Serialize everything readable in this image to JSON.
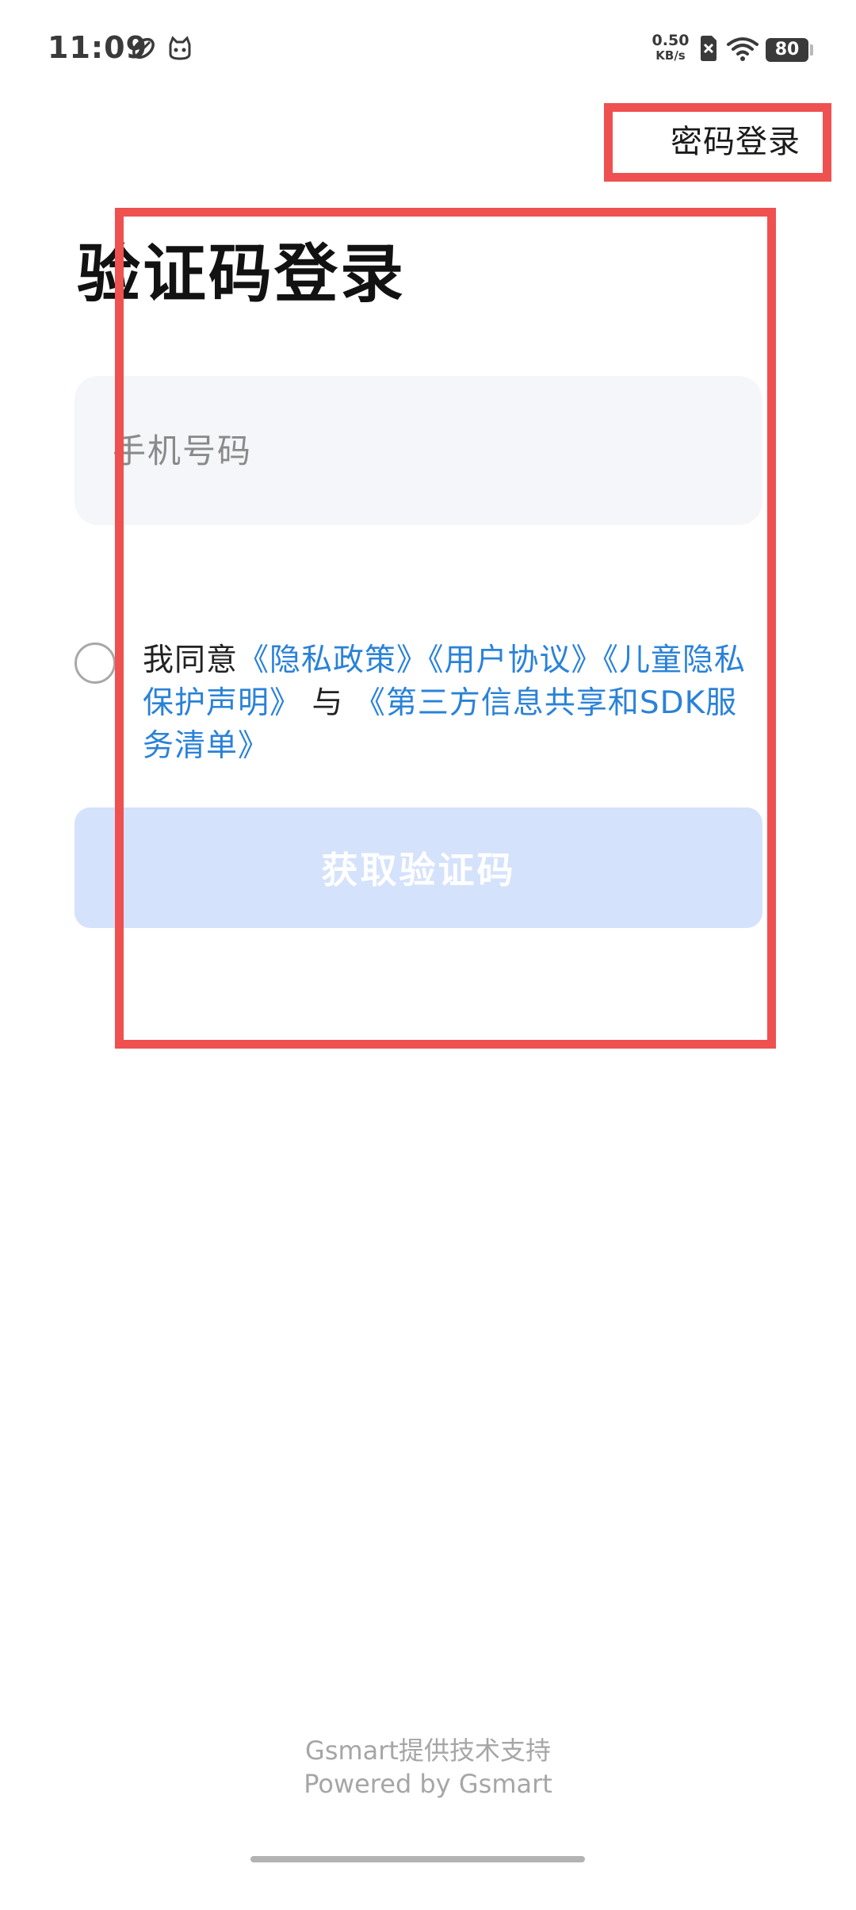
{
  "status_bar": {
    "time": "11:09",
    "net_speed_value": "0.50",
    "net_speed_unit": "KB/s",
    "battery_level": "80",
    "icons": [
      "rugby-ball-icon",
      "cat-face-icon",
      "sim-disabled-icon",
      "wifi-icon",
      "battery-icon"
    ]
  },
  "header": {
    "password_login": "密码登录"
  },
  "title": "验证码登录",
  "phone": {
    "placeholder": "手机号码",
    "value": ""
  },
  "agreement": {
    "prefix": "我同意",
    "privacy_policy": "《隐私政策》",
    "user_agreement": "《用户协议》",
    "child_privacy": "《儿童隐私保护声明》",
    "and": " 与 ",
    "third_party": "《第三方信息共享和SDK服务清单》",
    "checked": false
  },
  "button": {
    "get_code": "获取验证码",
    "enabled": false
  },
  "footer": {
    "line1": "Gsmart提供技术支持",
    "line2": "Powered by Gsmart"
  },
  "colors": {
    "link": "#2a82d8",
    "button_disabled": "#d5e2fc",
    "input_background": "#f5f6fa",
    "annotation": "#ee5150"
  }
}
